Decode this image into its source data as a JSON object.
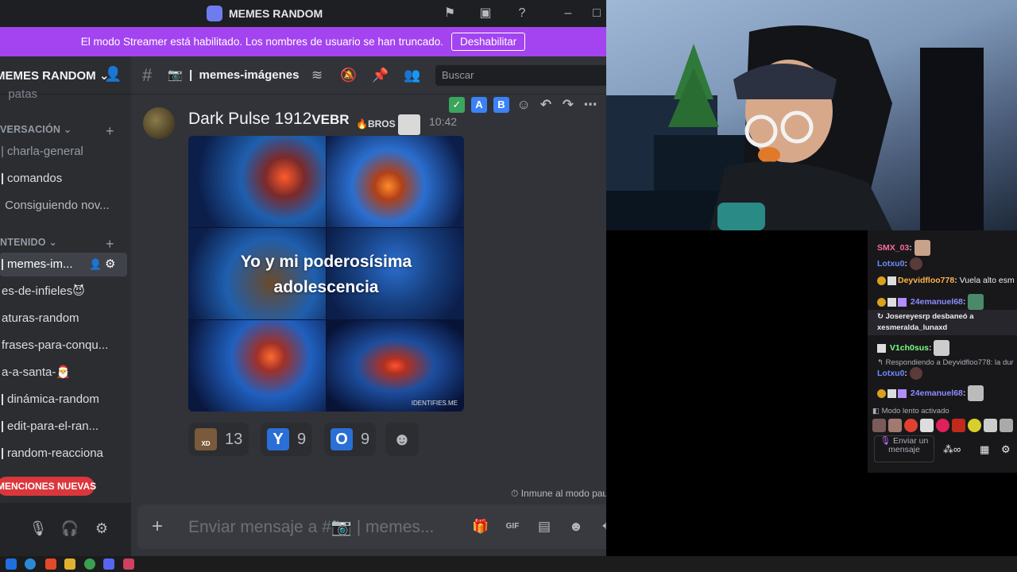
{
  "window": {
    "title": "MEMES RANDOM"
  },
  "streamer_banner": {
    "text": "El modo Streamer está habilitado. Los nombres de usuario se han truncado.",
    "button": "Deshabilitar"
  },
  "sidebar": {
    "server_name": "MEMES RANDOM",
    "top_item": "patas",
    "categories": [
      "VERSACIÓN",
      "NTENIDO"
    ],
    "channels": [
      "charla-general",
      "comandos",
      "Consiguiendo nov...",
      "memes-im...",
      "es-de-infieles😈",
      "aturas-random",
      "frases-para-conqu...",
      "a-a-santa-🎅",
      "dinámica-random",
      "edit-para-el-ran...",
      "random-reacciona"
    ],
    "mentions": "MENCIONES NUEVAS"
  },
  "header": {
    "channel_name": "memes-imágenes",
    "search_placeholder": "Buscar"
  },
  "message": {
    "author": "Dark Pulse 1912",
    "tag": "VEBR",
    "badge": "BROS",
    "timestamp": "10:42",
    "image_caption_line1": "Yo y mi poderosísima",
    "image_caption_line2": "adolescencia",
    "image_watermark": "IDENTIFIES.ME",
    "toolbar_labels": [
      "A",
      "B"
    ],
    "reactions": [
      {
        "emoji": "XD",
        "count": "13"
      },
      {
        "emoji": "Y",
        "count": "9"
      },
      {
        "emoji": "O",
        "count": "9"
      }
    ]
  },
  "footer": {
    "paused": "Inmune al modo pausado",
    "composer_placeholder": "Enviar mensaje a #",
    "composer_channel": "| memes..."
  },
  "chat": {
    "lines": [
      {
        "user": "SMX_03",
        "text": "",
        "color": "#ff6b9a"
      },
      {
        "user": "Lotxu0",
        "text": "",
        "color": "#6e8bff"
      },
      {
        "user": "Deyvidfloo778",
        "text": "Vuela alto esm",
        "color": "#ffb347"
      },
      {
        "user": "24emanuel68",
        "text": "",
        "color": "#8c8cff"
      },
      {
        "user": "V1ch0sus",
        "text": "",
        "color": "#7bff7b"
      },
      {
        "user": "Lotxu0",
        "text": "",
        "color": "#6e8bff"
      },
      {
        "user": "24emanuel68",
        "text": "",
        "color": "#8c8cff"
      }
    ],
    "ban_line1": "Josereyesrp desbaneó a",
    "ban_line2": "xesmeralda_lunaxd",
    "reply_line": "Respondiendo a Deyvidfloo778: la dur",
    "slow_mode": "Modo lento activado",
    "input_placeholder": "Enviar un mensaje"
  }
}
